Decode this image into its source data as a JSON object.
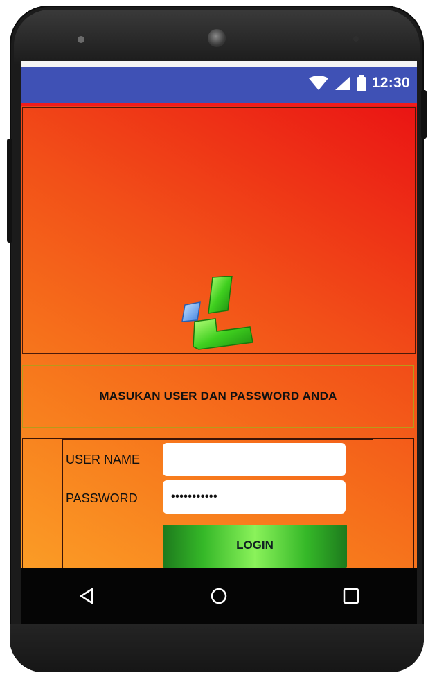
{
  "status_bar": {
    "time": "12:30",
    "icons": [
      "wifi-icon",
      "signal-icon",
      "battery-icon"
    ],
    "color": "#3f51b5"
  },
  "app": {
    "accent": "#ef1c1c",
    "logo": "app-logo-icon",
    "instruction": "MASUKAN USER DAN PASSWORD ANDA",
    "form": {
      "username_label": "USER NAME",
      "username_value": "",
      "password_label": "PASSWORD",
      "password_value": "•••••••••••",
      "login_label": "LOGIN"
    }
  },
  "nav_bar": {
    "buttons": [
      "back-icon",
      "home-icon",
      "recents-icon"
    ]
  }
}
